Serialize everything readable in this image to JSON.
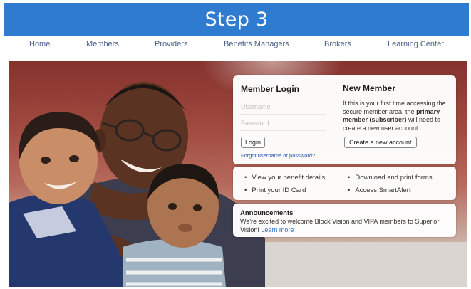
{
  "banner": {
    "title": "Step 3"
  },
  "nav": {
    "items": [
      "Home",
      "Members",
      "Providers",
      "Benefits Managers",
      "Brokers",
      "Learning Center"
    ]
  },
  "login": {
    "title": "Member Login",
    "username_placeholder": "Username",
    "password_placeholder": "Password",
    "login_button": "Login",
    "forgot_link": "Forgot username or password?"
  },
  "new_member": {
    "title": "New Member",
    "desc_before": "If this is your first time accessing the secure member area, the ",
    "desc_bold": "primary member (subscriber)",
    "desc_after": " will need to create a new user account",
    "create_button": "Create a new account"
  },
  "quick_links": {
    "bullet": "•",
    "items": [
      "View your benefit details",
      "Download and print forms",
      "Print your ID Card",
      "Access SmartAlert"
    ]
  },
  "announcements": {
    "title": "Announcements",
    "text": "We're excited to welcome Block Vision and VIPA members to Superior Vision! ",
    "link": "Learn more"
  },
  "colors": {
    "banner_blue": "#2e7bd0",
    "nav_text": "#4a5f86",
    "link_blue": "#2450b0"
  }
}
